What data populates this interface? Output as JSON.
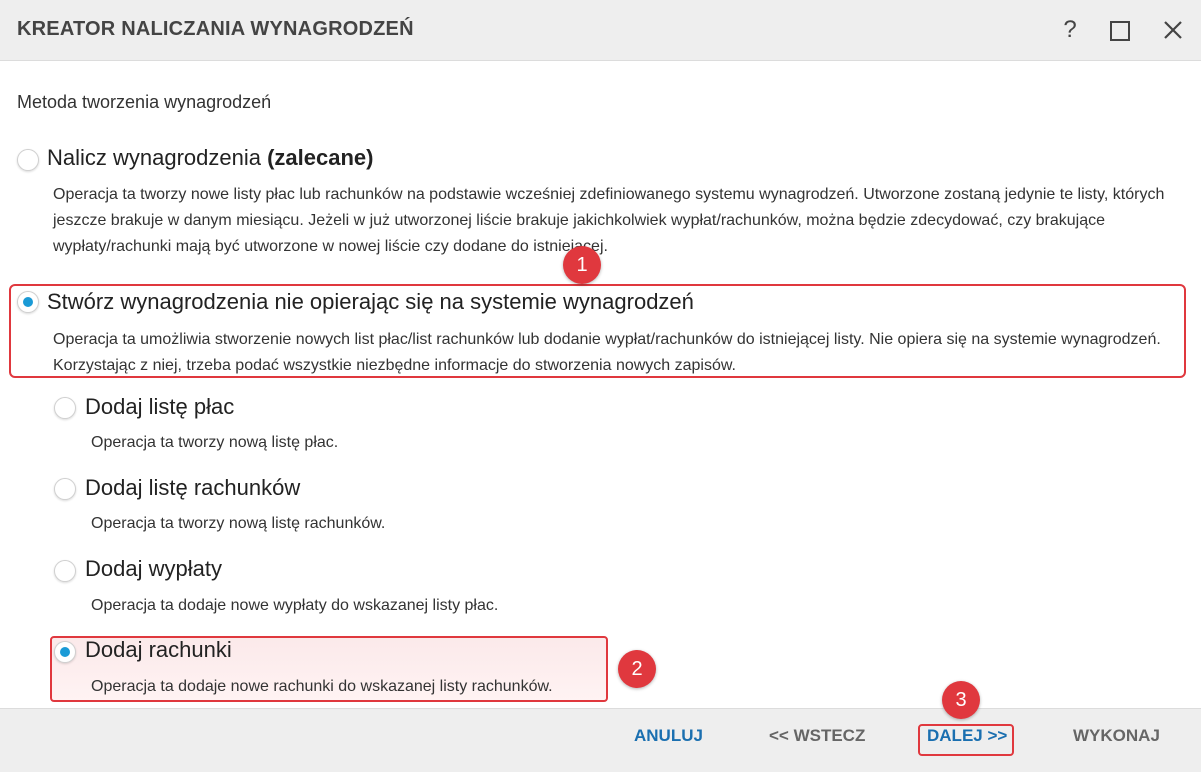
{
  "window": {
    "title": "KREATOR NALICZANIA WYNAGRODZEŃ",
    "help_label": "?"
  },
  "section_label": "Metoda tworzenia wynagrodzeń",
  "options": [
    {
      "title": "Nalicz wynagrodzenia ",
      "title_bold": "(zalecane)",
      "description": "Operacja ta tworzy nowe listy płac lub rachunków na podstawie wcześniej zdefiniowanego systemu wynagrodzeń. Utworzone zostaną jedynie te listy, których jeszcze brakuje w danym miesiącu. Jeżeli w już utworzonej liście brakuje jakichkolwiek wypłat/rachunków, można będzie zdecydować, czy brakujące wypłaty/rachunki mają być utworzone w nowej liście czy dodane do istniejącej.",
      "selected": false
    },
    {
      "title": "Stwórz wynagrodzenia nie opierając się na systemie wynagrodzeń",
      "description": "Operacja ta umożliwia stworzenie nowych list płac/list rachunków lub dodanie wypłat/rachunków do istniejącej listy. Nie opiera się na systemie wynagrodzeń. Korzystając z niej, trzeba podać wszystkie niezbędne informacje do stworzenia nowych zapisów.",
      "selected": true
    }
  ],
  "sub_options": [
    {
      "title": "Dodaj listę płac",
      "description": "Operacja ta tworzy nową listę płac.",
      "selected": false
    },
    {
      "title": "Dodaj listę rachunków",
      "description": "Operacja ta tworzy nową listę rachunków.",
      "selected": false
    },
    {
      "title": "Dodaj wypłaty",
      "description": "Operacja ta dodaje nowe wypłaty do wskazanej listy płac.",
      "selected": false
    },
    {
      "title": "Dodaj rachunki",
      "description": "Operacja ta dodaje nowe rachunki do wskazanej listy rachunków.",
      "selected": true
    }
  ],
  "badges": [
    "1",
    "2",
    "3"
  ],
  "footer": {
    "cancel": "ANULUJ",
    "back": "<< WSTECZ",
    "next": "DALEJ >>",
    "finish": "WYKONAJ"
  },
  "colors": {
    "accent": "#1a9ad6",
    "annotation": "#e0383e",
    "button_blue": "#1a6fb0"
  }
}
